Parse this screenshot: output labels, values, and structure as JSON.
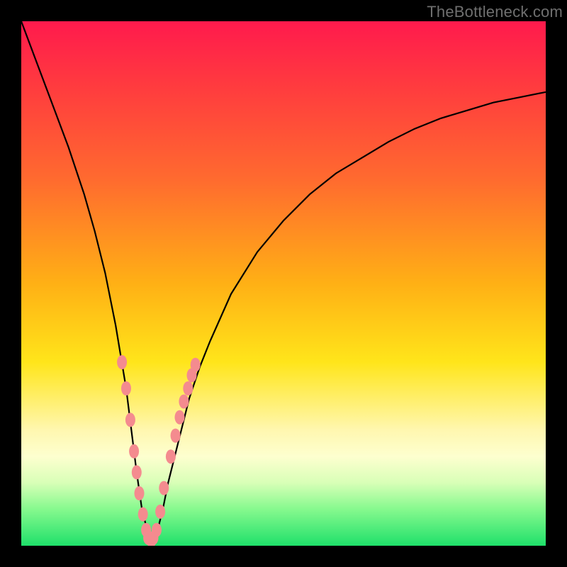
{
  "watermark": "TheBottleneck.com",
  "colors": {
    "frame": "#000000",
    "curve_stroke": "#000000",
    "marker_fill": "#f48b8f",
    "gradient_stops": [
      "#ff1a4d",
      "#ff3a3f",
      "#ff6a2f",
      "#ffb015",
      "#ffe51a",
      "#fff7b0",
      "#fdffcf",
      "#d8ffb7",
      "#86f98e",
      "#1fe06a"
    ]
  },
  "chart_data": {
    "type": "line",
    "title": "",
    "xlabel": "",
    "ylabel": "",
    "xlim": [
      0,
      100
    ],
    "ylim": [
      0,
      100
    ],
    "series": [
      {
        "name": "bottleneck-curve",
        "x": [
          0,
          3,
          6,
          9,
          12,
          14,
          16,
          18,
          20,
          21,
          22,
          23,
          24,
          25,
          26,
          27,
          28,
          30,
          32,
          34,
          36,
          40,
          45,
          50,
          55,
          60,
          65,
          70,
          75,
          80,
          85,
          90,
          95,
          100
        ],
        "y": [
          100,
          92,
          84,
          76,
          67,
          60,
          52,
          42,
          30,
          22,
          14,
          7,
          3,
          1,
          3,
          7,
          12,
          20,
          28,
          34,
          39,
          48,
          56,
          62,
          67,
          71,
          74,
          77,
          79.5,
          81.5,
          83,
          84.5,
          85.5,
          86.5
        ]
      }
    ],
    "markers": {
      "name": "highlighted-points",
      "x": [
        19.2,
        20.0,
        20.8,
        21.5,
        22.0,
        22.5,
        23.2,
        23.8,
        24.2,
        24.8,
        25.2,
        25.8,
        26.5,
        27.2,
        28.5,
        29.4,
        30.2,
        31.0,
        31.8,
        32.5,
        33.2
      ],
      "y": [
        35.0,
        30.0,
        24.0,
        18.0,
        14.0,
        10.0,
        6.0,
        3.0,
        1.5,
        1.0,
        1.5,
        3.0,
        6.5,
        11.0,
        17.0,
        21.0,
        24.5,
        27.5,
        30.0,
        32.5,
        34.5
      ]
    }
  }
}
